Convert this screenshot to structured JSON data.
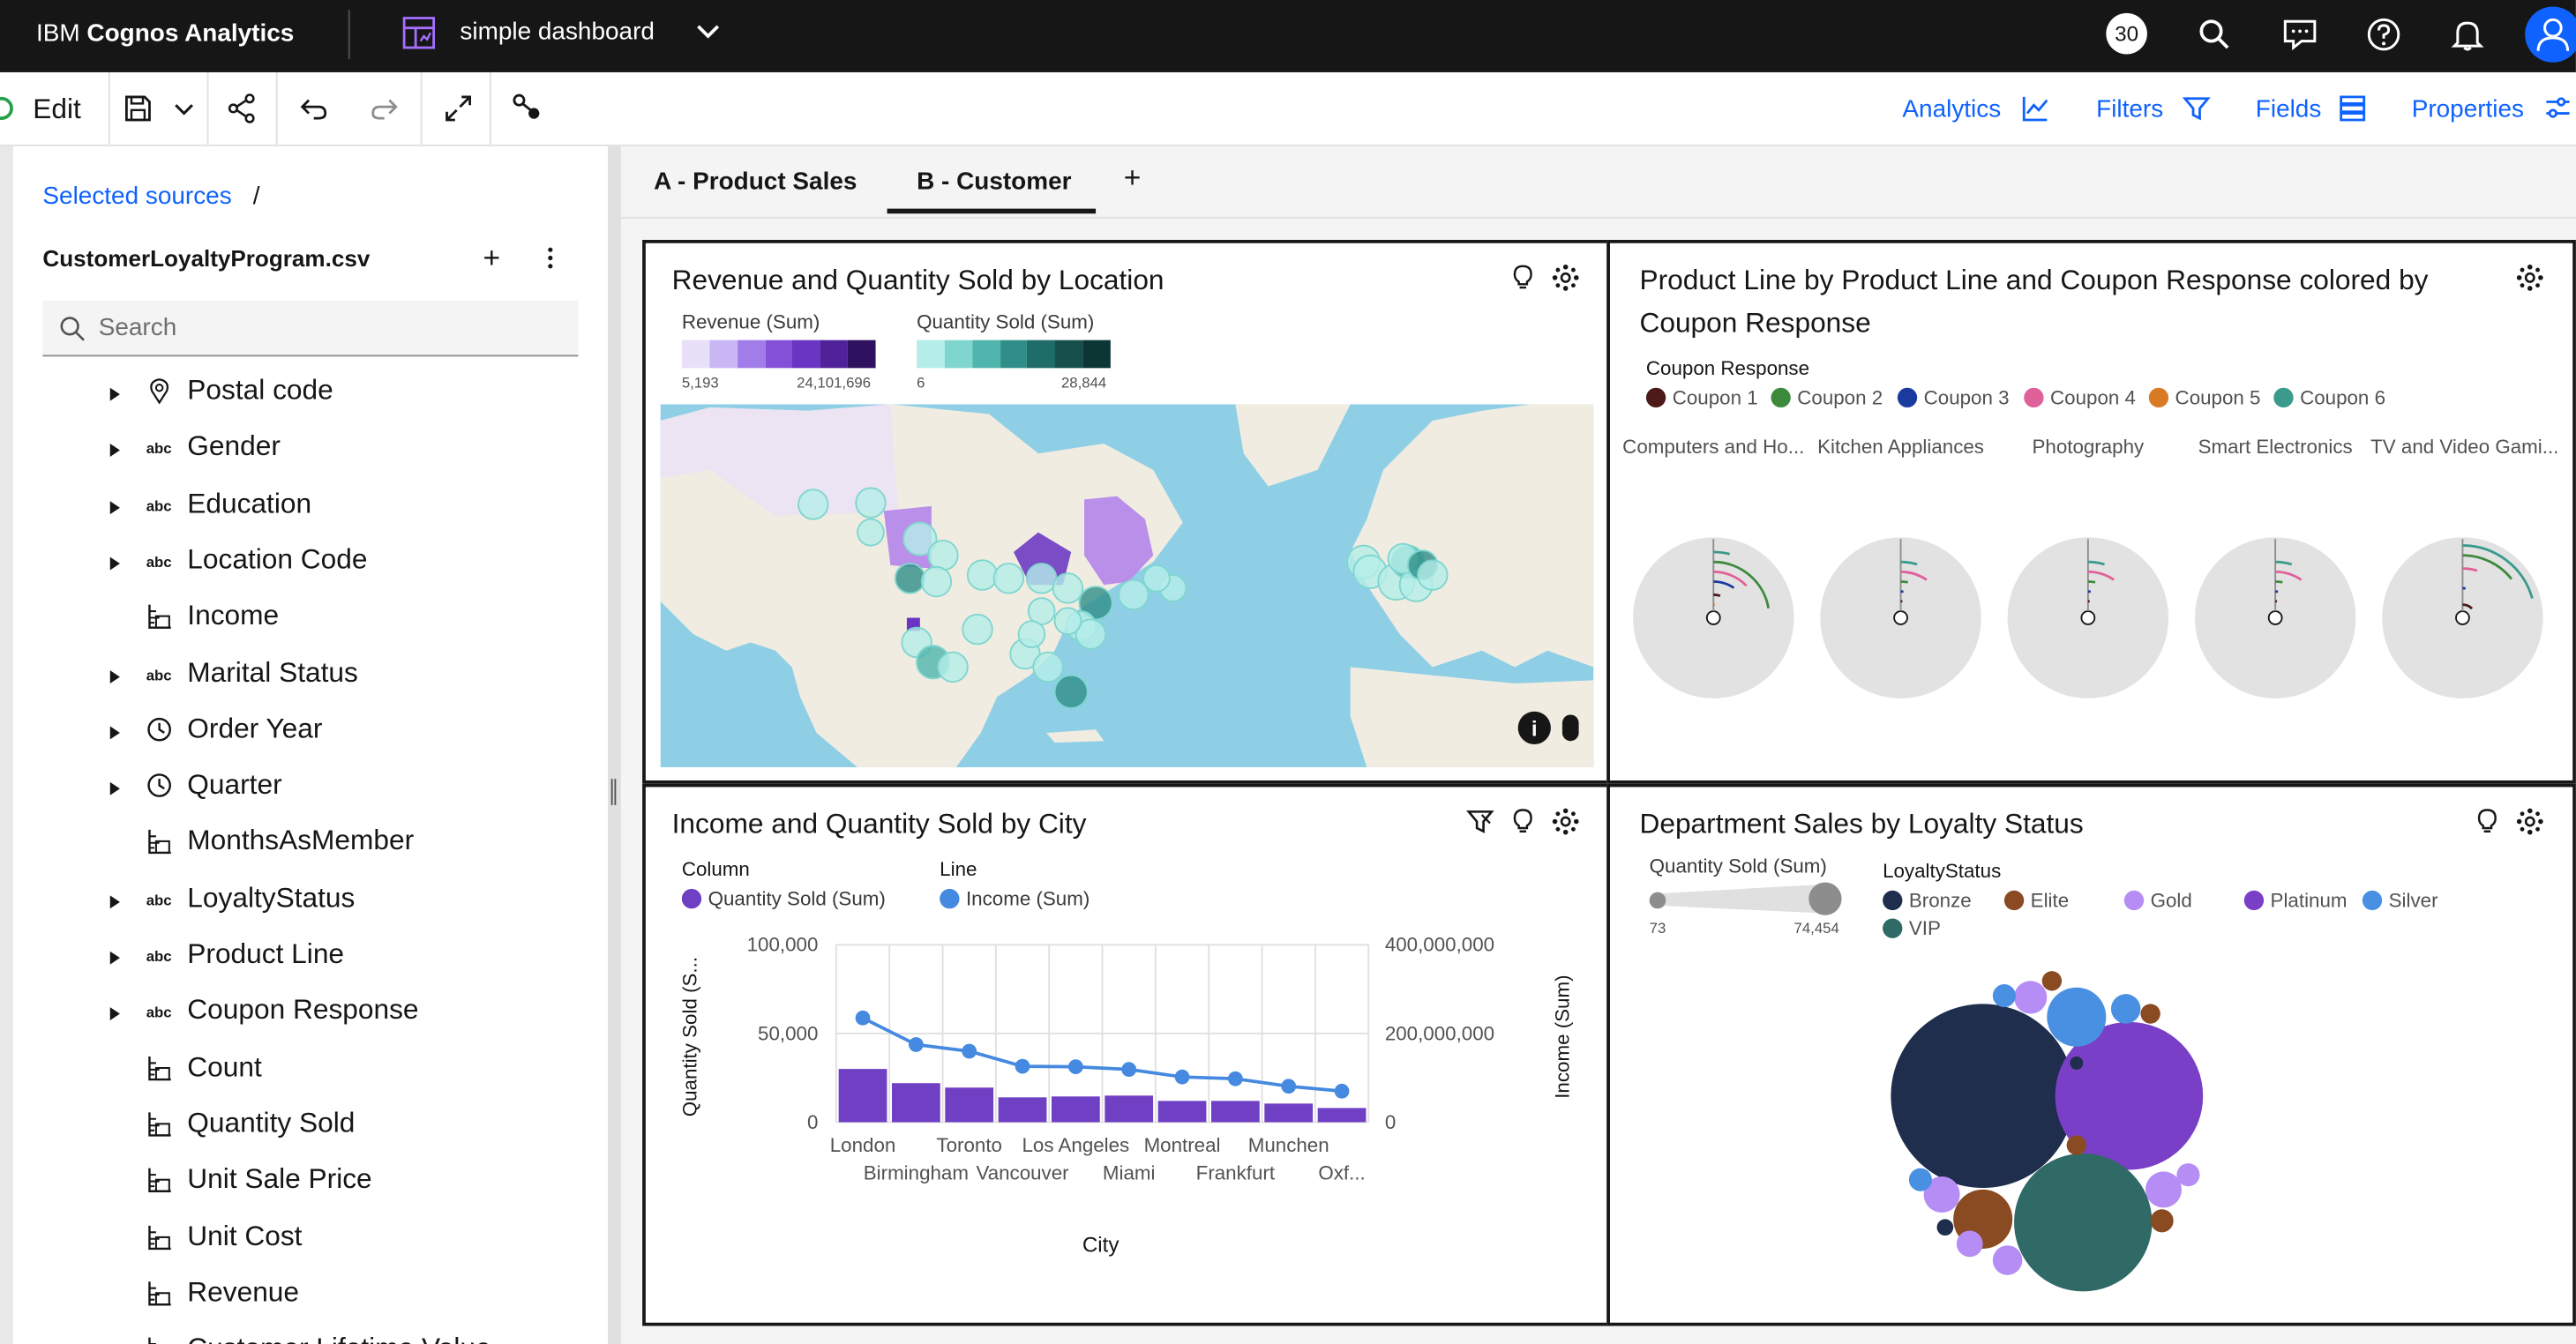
{
  "topbar": {
    "brand_prefix": "IBM ",
    "brand_bold": "Cognos Analytics",
    "dashboard_name": "simple dashboard",
    "notification_count": "30"
  },
  "toolbar": {
    "edit_label": "Edit",
    "analytics": "Analytics",
    "filters": "Filters",
    "fields": "Fields",
    "properties": "Properties"
  },
  "sources": {
    "breadcrumb": "Selected sources",
    "slash": "/",
    "file_name": "CustomerLoyaltyProgram.csv",
    "add": "+",
    "search_placeholder": "Search",
    "fields": [
      {
        "label": "Postal code",
        "icon": "location-icon",
        "expandable": true
      },
      {
        "label": "Gender",
        "icon": "text-abc-icon",
        "expandable": true
      },
      {
        "label": "Education",
        "icon": "text-abc-icon",
        "expandable": true
      },
      {
        "label": "Location Code",
        "icon": "text-abc-icon",
        "expandable": true
      },
      {
        "label": "Income",
        "icon": "measure-icon",
        "expandable": false
      },
      {
        "label": "Marital Status",
        "icon": "text-abc-icon",
        "expandable": true
      },
      {
        "label": "Order Year",
        "icon": "clock-icon",
        "expandable": true
      },
      {
        "label": "Quarter",
        "icon": "clock-icon",
        "expandable": true
      },
      {
        "label": "MonthsAsMember",
        "icon": "measure-icon",
        "expandable": false
      },
      {
        "label": "LoyaltyStatus",
        "icon": "text-abc-icon",
        "expandable": true
      },
      {
        "label": "Product Line",
        "icon": "text-abc-icon",
        "expandable": true
      },
      {
        "label": "Coupon Response",
        "icon": "text-abc-icon",
        "expandable": true
      },
      {
        "label": "Count",
        "icon": "measure-icon",
        "expandable": false
      },
      {
        "label": "Quantity Sold",
        "icon": "measure-icon",
        "expandable": false
      },
      {
        "label": "Unit Sale Price",
        "icon": "measure-icon",
        "expandable": false
      },
      {
        "label": "Unit Cost",
        "icon": "measure-icon",
        "expandable": false
      },
      {
        "label": "Revenue",
        "icon": "measure-icon",
        "expandable": false
      },
      {
        "label": "Customer Lifetime Value",
        "icon": "measure-icon",
        "expandable": false
      }
    ],
    "abc": "abc"
  },
  "tabs": [
    {
      "label": "A - Product Sales",
      "selected": false
    },
    {
      "label": "B - Customer",
      "selected": true
    }
  ],
  "tab_add": "+",
  "map_widget": {
    "title": "Revenue and Quantity Sold by Location",
    "legend_revenue": "Revenue (Sum)",
    "revenue_min": "5,193",
    "revenue_max": "24,101,696",
    "legend_qty": "Quantity Sold (Sum)",
    "qty_min": "6",
    "qty_max": "28,844",
    "revenue_colors": [
      "#e8e0f8",
      "#c9b6f5",
      "#a07de8",
      "#8450d8",
      "#6a35c2",
      "#4f229a",
      "#2e1260"
    ],
    "qty_colors": [
      "#b5ede9",
      "#7fd6cf",
      "#4fb5ad",
      "#2f8f88",
      "#1f6d68",
      "#15504d",
      "#0b3634"
    ]
  },
  "trellis_widget": {
    "title_line1": "Product Line by Product Line and Coupon Response colored by",
    "title_line2": "Coupon Response",
    "legend_title": "Coupon Response",
    "legend": [
      {
        "name": "Coupon 1",
        "color": "#4d1a1a"
      },
      {
        "name": "Coupon 2",
        "color": "#3d8a3d"
      },
      {
        "name": "Coupon 3",
        "color": "#1a3a9e"
      },
      {
        "name": "Coupon 4",
        "color": "#e0609a"
      },
      {
        "name": "Coupon 5",
        "color": "#d97a25"
      },
      {
        "name": "Coupon 6",
        "color": "#3a9a8c"
      }
    ],
    "panels": [
      "Computers and Ho...",
      "Kitchen Appliances",
      "Photography",
      "Smart Electronics",
      "TV and Video Gami..."
    ]
  },
  "combo_widget": {
    "title": "Income and Quantity Sold by City",
    "legend_column_title": "Column",
    "legend_column": "Quantity Sold (Sum)",
    "legend_line_title": "Line",
    "legend_line": "Income (Sum)",
    "column_color": "#6f3fc4",
    "line_color": "#4589e0"
  },
  "chart_data": {
    "type": "bar",
    "title": "Income and Quantity Sold by City",
    "xlabel": "City",
    "ylabel": "Quantity Sold (S...",
    "y2label": "Income (Sum)",
    "categories": [
      "London",
      "Birmingham",
      "Toronto",
      "Vancouver",
      "Los Angeles",
      "Miami",
      "Montreal",
      "Frankfurt",
      "Munchen",
      "Oxf..."
    ],
    "y_ticks": [
      "100,000",
      "50,000",
      "0"
    ],
    "y2_ticks": [
      "400,000,000",
      "200,000,000",
      "0"
    ],
    "ylim": [
      0,
      100000
    ],
    "y2lim": [
      0,
      400000000
    ],
    "series": [
      {
        "name": "Quantity Sold (Sum)",
        "type": "bar",
        "values": [
          30000,
          22000,
          19500,
          14000,
          14500,
          15000,
          12000,
          12000,
          10500,
          8000
        ]
      },
      {
        "name": "Income (Sum)",
        "type": "line",
        "values": [
          235000000,
          175000000,
          160000000,
          126000000,
          125000000,
          119000000,
          102000000,
          98000000,
          81000000,
          70000000
        ]
      }
    ]
  },
  "bubble_widget": {
    "title": "Department Sales by Loyalty Status",
    "size_legend_title": "Quantity Sold (Sum)",
    "size_min": "73",
    "size_max": "74,454",
    "color_legend_title": "LoyaltyStatus",
    "legend": [
      {
        "name": "Bronze",
        "color": "#1f2e4d"
      },
      {
        "name": "Elite",
        "color": "#8a4a22"
      },
      {
        "name": "Gold",
        "color": "#b68cf5"
      },
      {
        "name": "Platinum",
        "color": "#7a3fc7"
      },
      {
        "name": "Silver",
        "color": "#4a90e2"
      },
      {
        "name": "VIP",
        "color": "#2f6a66"
      }
    ]
  }
}
